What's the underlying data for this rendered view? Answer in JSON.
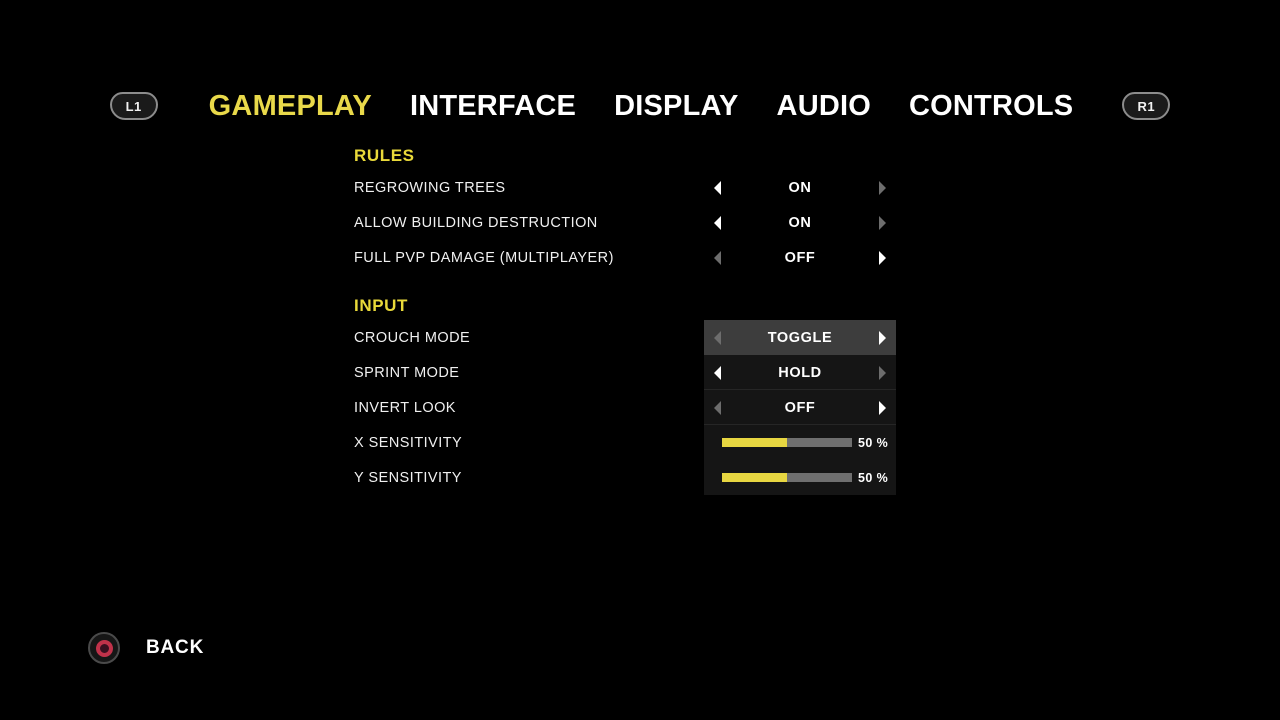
{
  "navigation": {
    "left_shoulder": "L1",
    "right_shoulder": "R1",
    "tabs": [
      {
        "label": "GAMEPLAY",
        "active": true
      },
      {
        "label": "INTERFACE",
        "active": false
      },
      {
        "label": "DISPLAY",
        "active": false
      },
      {
        "label": "AUDIO",
        "active": false
      },
      {
        "label": "CONTROLS",
        "active": false
      }
    ]
  },
  "sections": [
    {
      "title": "RULES",
      "rows": [
        {
          "label": "REGROWING TREES",
          "type": "option",
          "value": "ON",
          "left_arrow": "bright",
          "right_arrow": "dim",
          "selected": false,
          "shaded": false
        },
        {
          "label": "ALLOW BUILDING DESTRUCTION",
          "type": "option",
          "value": "ON",
          "left_arrow": "bright",
          "right_arrow": "dim",
          "selected": false,
          "shaded": false
        },
        {
          "label": "FULL PVP DAMAGE (MULTIPLAYER)",
          "type": "option",
          "value": "OFF",
          "left_arrow": "dim",
          "right_arrow": "bright",
          "selected": false,
          "shaded": false
        }
      ]
    },
    {
      "title": "INPUT",
      "rows": [
        {
          "label": "CROUCH MODE",
          "type": "option",
          "value": "TOGGLE",
          "left_arrow": "dim",
          "right_arrow": "bright",
          "selected": true,
          "shaded": true
        },
        {
          "label": "SPRINT MODE",
          "type": "option",
          "value": "HOLD",
          "left_arrow": "bright",
          "right_arrow": "dim",
          "selected": false,
          "shaded": true
        },
        {
          "label": "INVERT LOOK",
          "type": "option",
          "value": "OFF",
          "left_arrow": "dim",
          "right_arrow": "bright",
          "selected": false,
          "shaded": true
        },
        {
          "label": "X SENSITIVITY",
          "type": "slider",
          "value": "50 %",
          "percent": 50,
          "selected": false,
          "shaded": true
        },
        {
          "label": "Y SENSITIVITY",
          "type": "slider",
          "value": "50 %",
          "percent": 50,
          "selected": false,
          "shaded": true
        }
      ]
    }
  ],
  "footer": {
    "back_label": "BACK",
    "back_icon": "playstation-circle-icon"
  },
  "colors": {
    "accent_yellow": "#e9d93a",
    "tab_active": "#e9d94a",
    "slider_fill": "#e7d641",
    "slider_track": "#6f6f6f",
    "selected_row": "#3d3d3d",
    "row_background": "#151515",
    "circle_button_red": "#c0324a",
    "background": "#000000"
  }
}
